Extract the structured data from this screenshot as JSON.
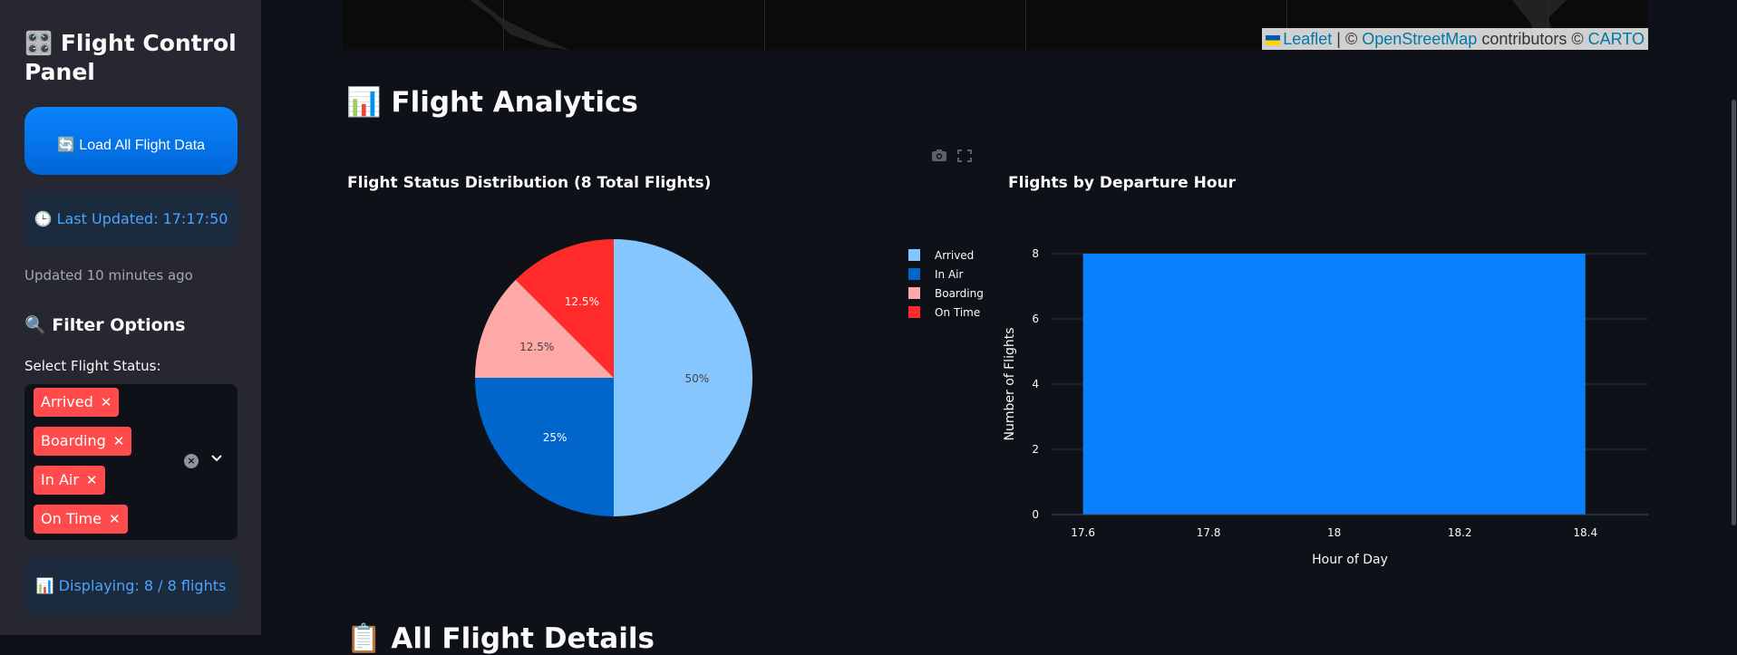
{
  "sidebar": {
    "title": "🎛️ Flight Control Panel",
    "load_button": "🔄 Load All Flight Data",
    "last_updated": "🕒 Last Updated: 17:17:50",
    "updated_ago": "Updated 10 minutes ago",
    "filter_heading": "🔍 Filter Options",
    "status_label": "Select Flight Status:",
    "selected_statuses": [
      "Arrived",
      "Boarding",
      "In Air",
      "On Time"
    ],
    "tag_remove_glyph": "✕",
    "displaying": "📊 Displaying: 8 / 8 flights"
  },
  "map": {
    "attr_sep1": " | © ",
    "leaflet": "Leaflet",
    "osm": "OpenStreetMap",
    "contributors": " contributors © ",
    "carto": "CARTO"
  },
  "main": {
    "analytics_heading": "📊 Flight Analytics",
    "next_heading": "📋 All Flight Details"
  },
  "colors": {
    "accent": "#0a84ff",
    "tag": "#ff4b4b",
    "arrived": "#85c6ff",
    "in_air": "#0066cc",
    "boarding": "#ffa8a8",
    "on_time": "#ff2b2b",
    "bar": "#0a80ff"
  },
  "chart_data": [
    {
      "type": "pie",
      "title": "Flight Status Distribution (8 Total Flights)",
      "labels": [
        "Arrived",
        "In Air",
        "Boarding",
        "On Time"
      ],
      "values": [
        4,
        2,
        1,
        1
      ],
      "percent_labels": [
        "50%",
        "25%",
        "12.5%",
        "12.5%"
      ],
      "legend_placement": "right"
    },
    {
      "type": "bar",
      "title": "Flights by Departure Hour",
      "x": [
        18
      ],
      "values": [
        8
      ],
      "xlabel": "Hour of Day",
      "ylabel": "Number of Flights",
      "xlim": [
        17.55,
        18.5
      ],
      "ylim": [
        0,
        8
      ],
      "xticks": [
        "17.6",
        "17.8",
        "18",
        "18.2",
        "18.4"
      ],
      "yticks": [
        "0",
        "2",
        "4",
        "6",
        "8"
      ],
      "grid": true
    }
  ]
}
